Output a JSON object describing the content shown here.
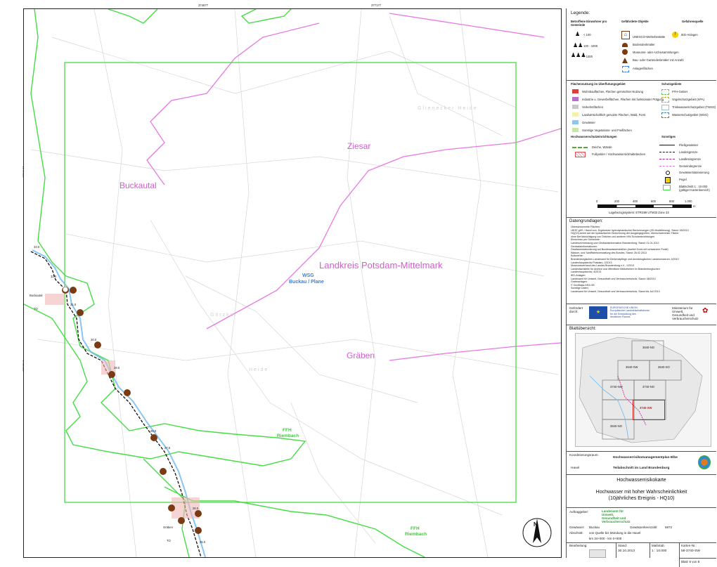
{
  "map": {
    "top_ticks": [
      "374677",
      "377177"
    ],
    "bottom_ticks": [
      "374677",
      "377177"
    ],
    "left_ticks": [
      "5798123",
      "5795513"
    ],
    "right_ticks": [
      "5798123",
      "5795513"
    ],
    "place_labels": {
      "ziesar": "Ziesar",
      "buckautal": "Buckautal",
      "landkreis": "Landkreis Potsdam-Mittelmark",
      "graeben": "Gräben",
      "glienecker": "Glienecker Heide",
      "goerzker": "Görzker",
      "heide": "Heide"
    },
    "wsg_label": [
      "WSG",
      "Buckau / Plane"
    ],
    "ffh_labels": [
      [
        "FFH",
        "Riembach"
      ],
      [
        "FFH",
        "Riembach"
      ]
    ],
    "river_km": [
      "25.0",
      "26.0",
      "27.0",
      "28.0",
      "29.0",
      "30.0",
      "31.0",
      "32.0",
      "33.0"
    ],
    "settlements": [
      "Buckautal",
      "Gräben"
    ],
    "settlement_marks": [
      "TO",
      "TO"
    ],
    "north_arrow": "N"
  },
  "legend": {
    "title": "Legende:",
    "col1_title": "Betroffene Einwohner pro Gemeinde",
    "col2_title": "Gefährdete Objekte",
    "col3_title": "Gefahrenquelle",
    "persons": [
      "< 100",
      "100 - 1000",
      "> 1000"
    ],
    "objects": [
      "UNESCO-Welterbestätte",
      "Bodendenkmäler",
      "Museums- oder Archivsammlungen",
      "Bau- oder Gartendenkmäler mit Anzahl",
      "Anlagenflächen"
    ],
    "hazard": "IED-Anlagen",
    "land_use_title": "Flächennutzung im Überflutungsgebiet",
    "land_use": [
      {
        "label": "Wohnbauflächen, Flächen gemischter Nutzung",
        "color": "#e03b3b"
      },
      {
        "label": "Industrie u. Gewerbeflächen, Flächen mit funktionaler Prägung",
        "color": "#b56ec9"
      },
      {
        "label": "Verkehrsflächen",
        "color": "#c9c9c9"
      },
      {
        "label": "Landwirtschaftlich genutzte Flächen, Wald, Forst",
        "color": "#f2f2a8"
      },
      {
        "label": "Gewässer",
        "color": "#8cc6ea"
      },
      {
        "label": "Sonstige Vegetations- und Freiflächen",
        "color": "#c6e8a6"
      }
    ],
    "protected_title": "Schutzgebiete",
    "protected": [
      "FFH-Gebiet",
      "Vogelschutzgebiet (SPA)",
      "Trinkwasserschutzgebiet (TWSG)",
      "Wasserschutzgebiet (WSG)"
    ],
    "flood_title": "Hochwasserschutzeinrichtungen",
    "flood": [
      "Deiche, Wände",
      "Fußpolder / Hochwasserrückhaltebecken"
    ],
    "misc_title": "Sonstiges",
    "misc": [
      "Fließgewässer",
      "Landesgrenze",
      "Landkreisgrenze",
      "Gemeindegrenze",
      "Gewässerstationierung",
      "Pegel",
      "Blattschnitt 1 : 10.000 (gültiger Kartenbereich)"
    ],
    "scale_ticks": [
      "0",
      "200",
      "400",
      "600",
      "800",
      "1.000"
    ],
    "scale_unit": "m",
    "crs": "Lagebezugssystem: ETRS89 UTM33 Zone 33"
  },
  "datagrundlagen": {
    "title": "Datengrundlagen:",
    "lines": [
      "Überschwemmte Flächen:",
      "   LBGE gHS / Havel-son, Ergebnisse hydrodynamischer Berechnungen (2D-Modellierung), Stand: 05/2013",
      "   HQ(10)-bereit auf der hydraulischen Berechnung der Ausgangsgrößen, überschwemmter Fläche",
      "   ohne Berücksichtigung von Deichen und anderen HW-Schutzeinrichtungen",
      "Einwohner pro Gemeinde:",
      "   Landesvermessung und Geobasisinformation Brandenburg, Stand: 01.01.2012",
      "Geobasisinformationen:",
      "Gewässerstationierung auf Bundeswasserstraßen (zweiter Kreis mit schwarzem Punkt)",
      "   Wasser- und Schifffahrtsverwaltung des Bundes, Stand: 26.02.2013",
      "Kulturerbe:",
      "   Brandenburgisches Landesamt für Denkmalpflege und Archäologisches Landesmuseum, 4/2010",
      "   Landeshauptarchiv Potsdam, 2/2013",
      "   Museumsverband des Landes Brandenburg e.V., 1/2013",
      "   Landesfachstelle für Archive und öffentliche Bibliotheken im Brandenburgischen",
      "   Landeshauptarchiv, 4/2013",
      "IED-Anlagen:",
      "   Landesamt für Umwelt, Gesundheit und Verbraucherschutz, Stand: 08/2013",
      "Grabeanlagen:",
      "   © GeoBasis-DE/LGB",
      "Sonstige Daten:",
      "   Landesamt für Umwelt, Gesundheit und Verbraucherschutz, Stand bis Juli 2013"
    ]
  },
  "funding": {
    "label": "Gefördert durch:",
    "eu_text": [
      "EUROPÄISCHE UNION",
      "Europäischer Landwirtschaftsfonds",
      "für die Entwicklung des",
      "ländlichen Raums"
    ],
    "ministry": [
      "Ministerium für",
      "Umwelt,",
      "Gesundheit und",
      "Verbraucherschutz"
    ]
  },
  "overview": {
    "title": "Blattübersicht:",
    "sheets": [
      "3640-NO",
      "3640-SW",
      "3640-SO",
      "3740-NW",
      "3740-NO",
      "3740-SW",
      "3840-NO"
    ],
    "current": "3740-SW"
  },
  "coordination": {
    "label": "Koordinierungsraum:",
    "value": "Havel",
    "plan_title": "Hochwasserrisikomanagementplan Elbe",
    "plan_sub": "Teilabschnitt im Land Brandenburg"
  },
  "titleblock": {
    "map_type": "Hochwasserrisikokarte",
    "scenario_line1": "Hochwasser mit hoher Wahrscheinlichkeit",
    "scenario_line2": "(10jährliches Ereignis - HQ10)"
  },
  "auftraggeber": {
    "label": "Auftraggeber:",
    "name_lines": [
      "Landesamt für",
      "Umwelt,",
      "Gesundheit und",
      "Verbraucherschutz"
    ],
    "gewaesser_label": "Gewässer:",
    "gewaesser": "Buckau",
    "kennzahl_label": "Gewässerkennzahl:",
    "kennzahl": "5872",
    "abschnitt_label": "Abschnitt:",
    "abschnitt": "von Quelle bis Mündung in die Havel",
    "km": "km 34+000 - km 0+000"
  },
  "footer": {
    "bearbeitung_label": "Bearbeitung:",
    "stand_label": "Stand:",
    "stand": "30.10.2013",
    "massstab_label": "Maßstab:",
    "massstab": "1 : 10.000",
    "karten_label": "Karten-Nr.:",
    "karten_nr": "58-3740-SW",
    "blatt": "Blatt: 6 von 8"
  }
}
